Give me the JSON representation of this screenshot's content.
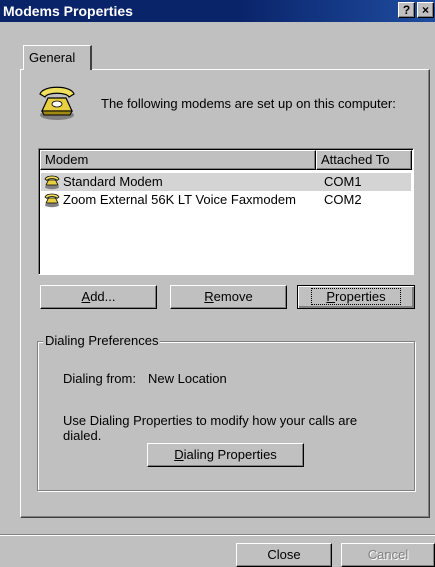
{
  "window": {
    "title": "Modems Properties",
    "help_btn": "?",
    "close_btn": "×"
  },
  "tabs": [
    {
      "label": "General"
    }
  ],
  "intro_text": "The following modems are set up on this computer:",
  "modem_list": {
    "columns": [
      "Modem",
      "Attached To"
    ],
    "rows": [
      {
        "name": "Standard Modem",
        "port": "COM1",
        "selected": true
      },
      {
        "name": "Zoom External 56K LT Voice Faxmodem",
        "port": "COM2",
        "selected": false
      }
    ]
  },
  "buttons": {
    "add": {
      "pre": "",
      "key": "A",
      "post": "dd..."
    },
    "remove": {
      "pre": "",
      "key": "R",
      "post": "emove"
    },
    "properties": {
      "pre": "",
      "key": "P",
      "post": "roperties"
    }
  },
  "dialing": {
    "group_label": "Dialing Preferences",
    "from_label": "Dialing from:",
    "from_value": "New Location",
    "help_line1": "Use Dialing Properties to modify how your calls are",
    "help_line2": "dialed.",
    "button": {
      "pre": "",
      "key": "D",
      "post": "ialing Properties"
    }
  },
  "footer": {
    "close_label": "Close",
    "cancel_label": "Cancel"
  },
  "colors": {
    "titlebar": "#0a246a",
    "face": "#c0c0c0",
    "selection": "#d4d4d4"
  },
  "icons": [
    "phone-icon",
    "modem-icon"
  ]
}
